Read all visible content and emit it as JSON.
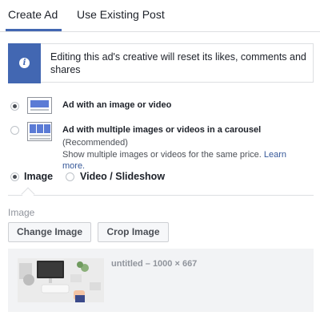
{
  "tabs": {
    "create_ad": "Create Ad",
    "use_existing_post": "Use Existing Post"
  },
  "notice": {
    "text": "Editing this ad's creative will reset its likes, comments and shares",
    "icon": "info-icon"
  },
  "ad_formats": [
    {
      "title": "Ad with an image or video",
      "selected": true,
      "icon": "single-image-format-icon"
    },
    {
      "title": "Ad with multiple images or videos in a carousel",
      "recommended": "(Recommended)",
      "description": "Show multiple images or videos for the same price.",
      "link": "Learn more.",
      "selected": false,
      "icon": "carousel-format-icon"
    }
  ],
  "media_type": {
    "image_label": "Image",
    "video_label": "Video / Slideshow",
    "selected": "Image"
  },
  "image_section": {
    "label": "Image",
    "change_button": "Change Image",
    "crop_button": "Crop Image",
    "file_label": "untitled – 1000 × 667"
  },
  "colors": {
    "accent": "#4267b2",
    "link": "#365899"
  }
}
